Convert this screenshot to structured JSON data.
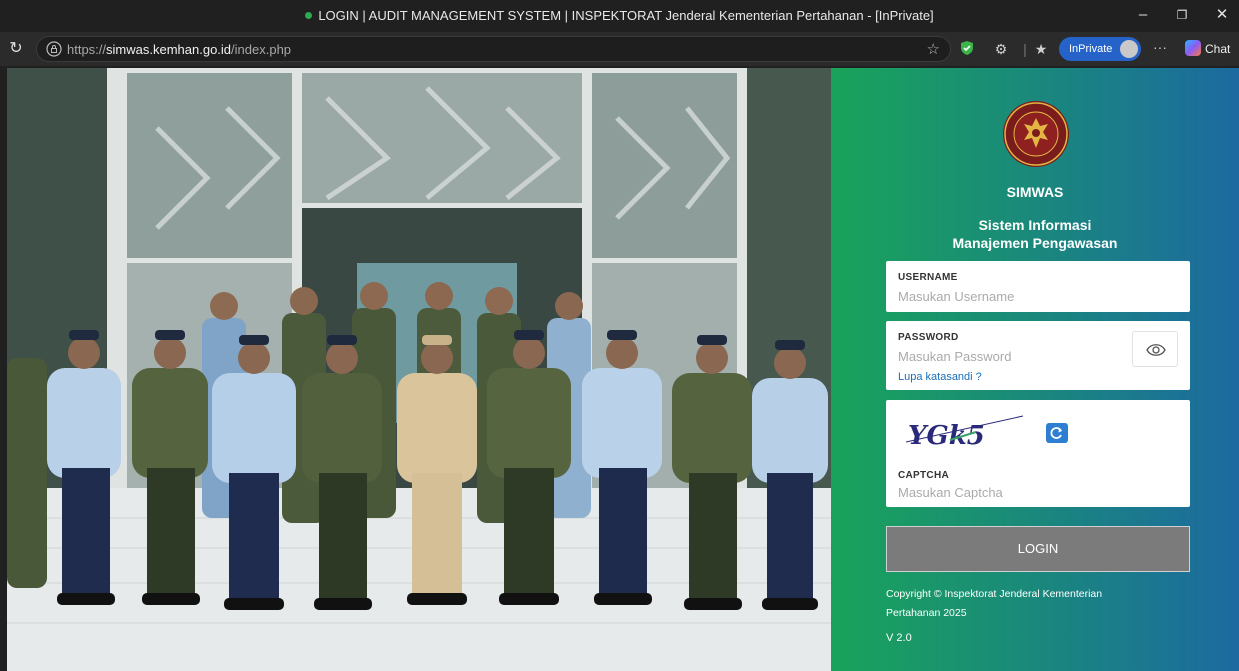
{
  "browser": {
    "window_title": "LOGIN | AUDIT MANAGEMENT SYSTEM | INSPEKTORAT Jenderal Kementerian Pertahanan - [InPrivate]",
    "url_prefix": "https://",
    "url_host": "simwas.kemhan.go.id",
    "url_path": "/index.php",
    "inprivate_label": "InPrivate",
    "chat_label": "Chat",
    "more_label": "···"
  },
  "login": {
    "app_name": "SIMWAS",
    "subtitle_line1": "Sistem Informasi",
    "subtitle_line2": "Manajemen Pengawasan",
    "username_label": "USERNAME",
    "username_placeholder": "Masukan Username",
    "password_label": "PASSWORD",
    "password_placeholder": "Masukan Password",
    "forgot_label": "Lupa katasandi ?",
    "captcha_text": "YGk5",
    "captcha_label": "CAPTCHA",
    "captcha_placeholder": "Masukan Captcha",
    "login_button": "LOGIN",
    "copyright": "Copyright © Inspektorat Jenderal Kementerian Pertahanan 2025",
    "version": "V 2.0"
  },
  "colors": {
    "panel_gradient_start": "#19a35a",
    "panel_gradient_end": "#1c6aa0",
    "login_button": "#7b7b7b",
    "link": "#1b6fb8"
  }
}
